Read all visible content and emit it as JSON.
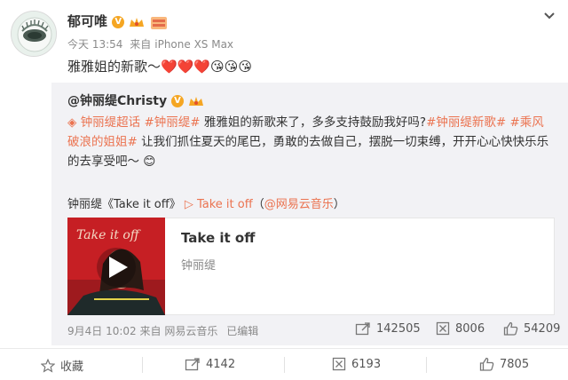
{
  "post": {
    "author": "郁可唯",
    "time": "今天 13:54",
    "source_prefix": "来自",
    "source": "iPhone XS Max",
    "text": "雅雅姐的新歌～",
    "emojis": "❤️❤️❤️😘😘😘"
  },
  "repost": {
    "author": "@钟丽缇Christy",
    "body_tag1": "钟丽缇超话",
    "body_tag2": "#钟丽缇#",
    "body_text1": "雅雅姐的新歌来了，多多支持鼓励我好吗?",
    "body_tag3": "#钟丽缇新歌#",
    "body_tag4": "#乘风破浪的姐姐#",
    "body_text2": "让我们抓住夏天的尾巴，勇敢的去做自己，摆脱一切束缚，开开心心快快乐乐的去享受吧～",
    "emoji": "😊",
    "music_line_prefix": "钟丽缇《Take it off》",
    "music_link": "Take it off",
    "music_suffix_open": "（",
    "music_platform": "@网易云音乐",
    "music_suffix_close": "）",
    "card": {
      "title": "Take it off",
      "artist": "钟丽缇",
      "cover_text": "Take it off"
    },
    "date": "9月4日 10:02",
    "source_prefix": "来自",
    "source": "网易云音乐",
    "edited": "已编辑",
    "reposts": "142505",
    "comments": "8006",
    "likes": "54209"
  },
  "actions": {
    "favorite": "收藏",
    "repost": "4142",
    "comment": "6193",
    "like": "7805"
  }
}
